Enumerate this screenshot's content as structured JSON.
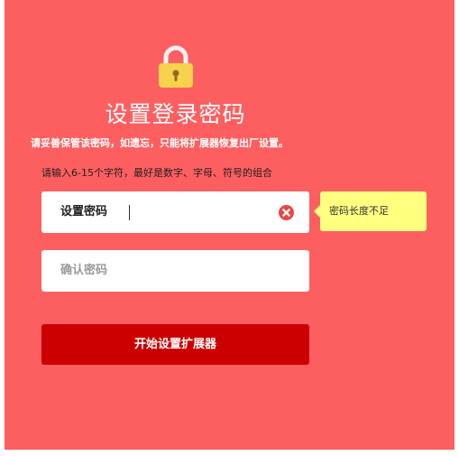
{
  "page": {
    "title": "设置登录密码",
    "warning": "请妥善保管该密码，如遗忘，只能将扩展器恢复出厂设置。",
    "hint": "请输入6-15个字符，最好是数字、字母、符号的组合"
  },
  "form": {
    "password_label": "设置密码",
    "password_value": "",
    "confirm_placeholder": "确认密码",
    "submit_label": "开始设置扩展器"
  },
  "tooltip": {
    "text": "密码长度不足"
  },
  "colors": {
    "background": "#fd5f61",
    "button": "#cc0000",
    "tooltip": "#ffff80",
    "lock": "#f6d24e",
    "clear_icon": "#e8474a"
  },
  "icons": {
    "lock": "lock-icon",
    "clear": "clear-x-icon"
  }
}
